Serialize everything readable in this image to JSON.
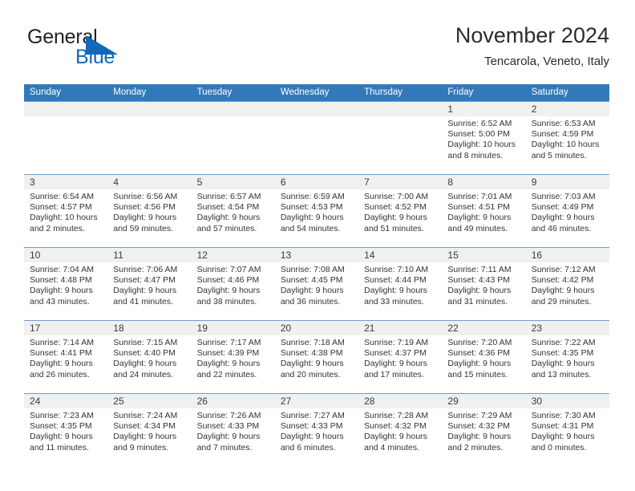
{
  "brand": {
    "name_part1": "General",
    "name_part2": "Blue",
    "triangle_color": "#1368b8",
    "text_color": "#221f1f"
  },
  "header": {
    "title": "November 2024",
    "subtitle": "Tencarola, Veneto, Italy"
  },
  "theme": {
    "header_blue": "#3279bb",
    "row_line": "#6f9ec9",
    "date_band": "#f0f0f0",
    "text": "#333333"
  },
  "weekdays": [
    "Sunday",
    "Monday",
    "Tuesday",
    "Wednesday",
    "Thursday",
    "Friday",
    "Saturday"
  ],
  "weeks": [
    [
      {
        "day": "",
        "empty": true
      },
      {
        "day": "",
        "empty": true
      },
      {
        "day": "",
        "empty": true
      },
      {
        "day": "",
        "empty": true
      },
      {
        "day": "",
        "empty": true
      },
      {
        "day": "1",
        "sunrise": "Sunrise: 6:52 AM",
        "sunset": "Sunset: 5:00 PM",
        "daylight": "Daylight: 10 hours and 8 minutes."
      },
      {
        "day": "2",
        "sunrise": "Sunrise: 6:53 AM",
        "sunset": "Sunset: 4:59 PM",
        "daylight": "Daylight: 10 hours and 5 minutes."
      }
    ],
    [
      {
        "day": "3",
        "sunrise": "Sunrise: 6:54 AM",
        "sunset": "Sunset: 4:57 PM",
        "daylight": "Daylight: 10 hours and 2 minutes."
      },
      {
        "day": "4",
        "sunrise": "Sunrise: 6:56 AM",
        "sunset": "Sunset: 4:56 PM",
        "daylight": "Daylight: 9 hours and 59 minutes."
      },
      {
        "day": "5",
        "sunrise": "Sunrise: 6:57 AM",
        "sunset": "Sunset: 4:54 PM",
        "daylight": "Daylight: 9 hours and 57 minutes."
      },
      {
        "day": "6",
        "sunrise": "Sunrise: 6:59 AM",
        "sunset": "Sunset: 4:53 PM",
        "daylight": "Daylight: 9 hours and 54 minutes."
      },
      {
        "day": "7",
        "sunrise": "Sunrise: 7:00 AM",
        "sunset": "Sunset: 4:52 PM",
        "daylight": "Daylight: 9 hours and 51 minutes."
      },
      {
        "day": "8",
        "sunrise": "Sunrise: 7:01 AM",
        "sunset": "Sunset: 4:51 PM",
        "daylight": "Daylight: 9 hours and 49 minutes."
      },
      {
        "day": "9",
        "sunrise": "Sunrise: 7:03 AM",
        "sunset": "Sunset: 4:49 PM",
        "daylight": "Daylight: 9 hours and 46 minutes."
      }
    ],
    [
      {
        "day": "10",
        "sunrise": "Sunrise: 7:04 AM",
        "sunset": "Sunset: 4:48 PM",
        "daylight": "Daylight: 9 hours and 43 minutes."
      },
      {
        "day": "11",
        "sunrise": "Sunrise: 7:06 AM",
        "sunset": "Sunset: 4:47 PM",
        "daylight": "Daylight: 9 hours and 41 minutes."
      },
      {
        "day": "12",
        "sunrise": "Sunrise: 7:07 AM",
        "sunset": "Sunset: 4:46 PM",
        "daylight": "Daylight: 9 hours and 38 minutes."
      },
      {
        "day": "13",
        "sunrise": "Sunrise: 7:08 AM",
        "sunset": "Sunset: 4:45 PM",
        "daylight": "Daylight: 9 hours and 36 minutes."
      },
      {
        "day": "14",
        "sunrise": "Sunrise: 7:10 AM",
        "sunset": "Sunset: 4:44 PM",
        "daylight": "Daylight: 9 hours and 33 minutes."
      },
      {
        "day": "15",
        "sunrise": "Sunrise: 7:11 AM",
        "sunset": "Sunset: 4:43 PM",
        "daylight": "Daylight: 9 hours and 31 minutes."
      },
      {
        "day": "16",
        "sunrise": "Sunrise: 7:12 AM",
        "sunset": "Sunset: 4:42 PM",
        "daylight": "Daylight: 9 hours and 29 minutes."
      }
    ],
    [
      {
        "day": "17",
        "sunrise": "Sunrise: 7:14 AM",
        "sunset": "Sunset: 4:41 PM",
        "daylight": "Daylight: 9 hours and 26 minutes."
      },
      {
        "day": "18",
        "sunrise": "Sunrise: 7:15 AM",
        "sunset": "Sunset: 4:40 PM",
        "daylight": "Daylight: 9 hours and 24 minutes."
      },
      {
        "day": "19",
        "sunrise": "Sunrise: 7:17 AM",
        "sunset": "Sunset: 4:39 PM",
        "daylight": "Daylight: 9 hours and 22 minutes."
      },
      {
        "day": "20",
        "sunrise": "Sunrise: 7:18 AM",
        "sunset": "Sunset: 4:38 PM",
        "daylight": "Daylight: 9 hours and 20 minutes."
      },
      {
        "day": "21",
        "sunrise": "Sunrise: 7:19 AM",
        "sunset": "Sunset: 4:37 PM",
        "daylight": "Daylight: 9 hours and 17 minutes."
      },
      {
        "day": "22",
        "sunrise": "Sunrise: 7:20 AM",
        "sunset": "Sunset: 4:36 PM",
        "daylight": "Daylight: 9 hours and 15 minutes."
      },
      {
        "day": "23",
        "sunrise": "Sunrise: 7:22 AM",
        "sunset": "Sunset: 4:35 PM",
        "daylight": "Daylight: 9 hours and 13 minutes."
      }
    ],
    [
      {
        "day": "24",
        "sunrise": "Sunrise: 7:23 AM",
        "sunset": "Sunset: 4:35 PM",
        "daylight": "Daylight: 9 hours and 11 minutes."
      },
      {
        "day": "25",
        "sunrise": "Sunrise: 7:24 AM",
        "sunset": "Sunset: 4:34 PM",
        "daylight": "Daylight: 9 hours and 9 minutes."
      },
      {
        "day": "26",
        "sunrise": "Sunrise: 7:26 AM",
        "sunset": "Sunset: 4:33 PM",
        "daylight": "Daylight: 9 hours and 7 minutes."
      },
      {
        "day": "27",
        "sunrise": "Sunrise: 7:27 AM",
        "sunset": "Sunset: 4:33 PM",
        "daylight": "Daylight: 9 hours and 6 minutes."
      },
      {
        "day": "28",
        "sunrise": "Sunrise: 7:28 AM",
        "sunset": "Sunset: 4:32 PM",
        "daylight": "Daylight: 9 hours and 4 minutes."
      },
      {
        "day": "29",
        "sunrise": "Sunrise: 7:29 AM",
        "sunset": "Sunset: 4:32 PM",
        "daylight": "Daylight: 9 hours and 2 minutes."
      },
      {
        "day": "30",
        "sunrise": "Sunrise: 7:30 AM",
        "sunset": "Sunset: 4:31 PM",
        "daylight": "Daylight: 9 hours and 0 minutes."
      }
    ]
  ]
}
